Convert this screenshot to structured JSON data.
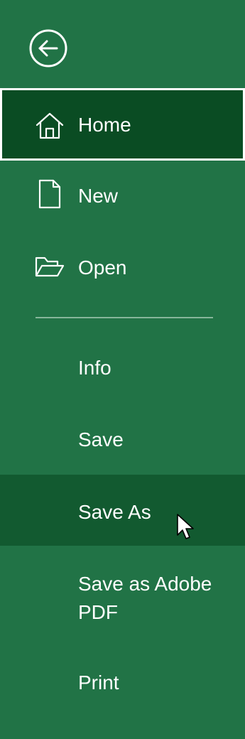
{
  "back": {
    "icon": "back-arrow-circle-icon"
  },
  "nav": {
    "home": {
      "label": "Home",
      "icon": "home-icon"
    },
    "new": {
      "label": "New",
      "icon": "new-document-icon"
    },
    "open": {
      "label": "Open",
      "icon": "folder-open-icon"
    },
    "info": {
      "label": "Info"
    },
    "save": {
      "label": "Save"
    },
    "save_as": {
      "label": "Save As"
    },
    "save_as_pdf": {
      "label": "Save as Adobe PDF"
    },
    "print": {
      "label": "Print"
    }
  },
  "colors": {
    "background": "#217346",
    "selected": "#0a4c23",
    "hover": "#125a30",
    "text": "#ffffff"
  }
}
